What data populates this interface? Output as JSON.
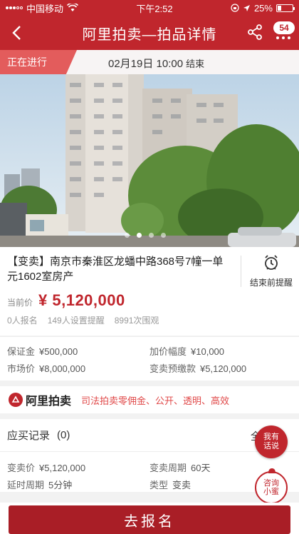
{
  "status_bar": {
    "carrier": "中国移动",
    "time": "下午2:52",
    "battery": "25%",
    "battery_level": 0.25
  },
  "nav": {
    "title": "阿里拍卖—拍品详情",
    "message_count": "54"
  },
  "countdown": {
    "status_tag": "正在进行",
    "end_time": "02月19日 10:00",
    "end_label": "结束"
  },
  "photo": {
    "total_slides": 4,
    "current_slide": 2
  },
  "lot": {
    "title": "【变卖】南京市秦淮区龙蟠中路368号7幢一单元1602室房产",
    "remind_label": "结束前提醒",
    "price_label": "当前价",
    "price": "¥ 5,120,000",
    "stats": [
      "0人报名",
      "149人设置提醒",
      "8991次围观"
    ]
  },
  "details": [
    {
      "key": "保证金",
      "value": "¥500,000"
    },
    {
      "key": "加价幅度",
      "value": "¥10,000"
    },
    {
      "key": "市场价",
      "value": "¥8,000,000"
    },
    {
      "key": "变卖预缴款",
      "value": "¥5,120,000"
    }
  ],
  "promo": {
    "logo_text": "阿里拍卖",
    "slogan": "司法拍卖零佣金、公开、透明、高效"
  },
  "records": {
    "label": "应买记录",
    "count": "(0)",
    "all_label": "全"
  },
  "details2": [
    {
      "key": "变卖价",
      "value": "¥5,120,000"
    },
    {
      "key": "变卖周期",
      "value": "60天"
    },
    {
      "key": "延时周期",
      "value": "5分钟"
    },
    {
      "key": "类型",
      "value": "变卖"
    }
  ],
  "floating": {
    "chat_line1": "我有",
    "chat_line2": "话说",
    "help_line1": "咨询",
    "help_line2": "小蜜"
  },
  "cta": {
    "register_label": "去报名"
  },
  "colors": {
    "brand_red": "#c0262d",
    "price_red": "#c0262d",
    "live_tag": "#e35c5c",
    "cta": "#a91e26"
  }
}
